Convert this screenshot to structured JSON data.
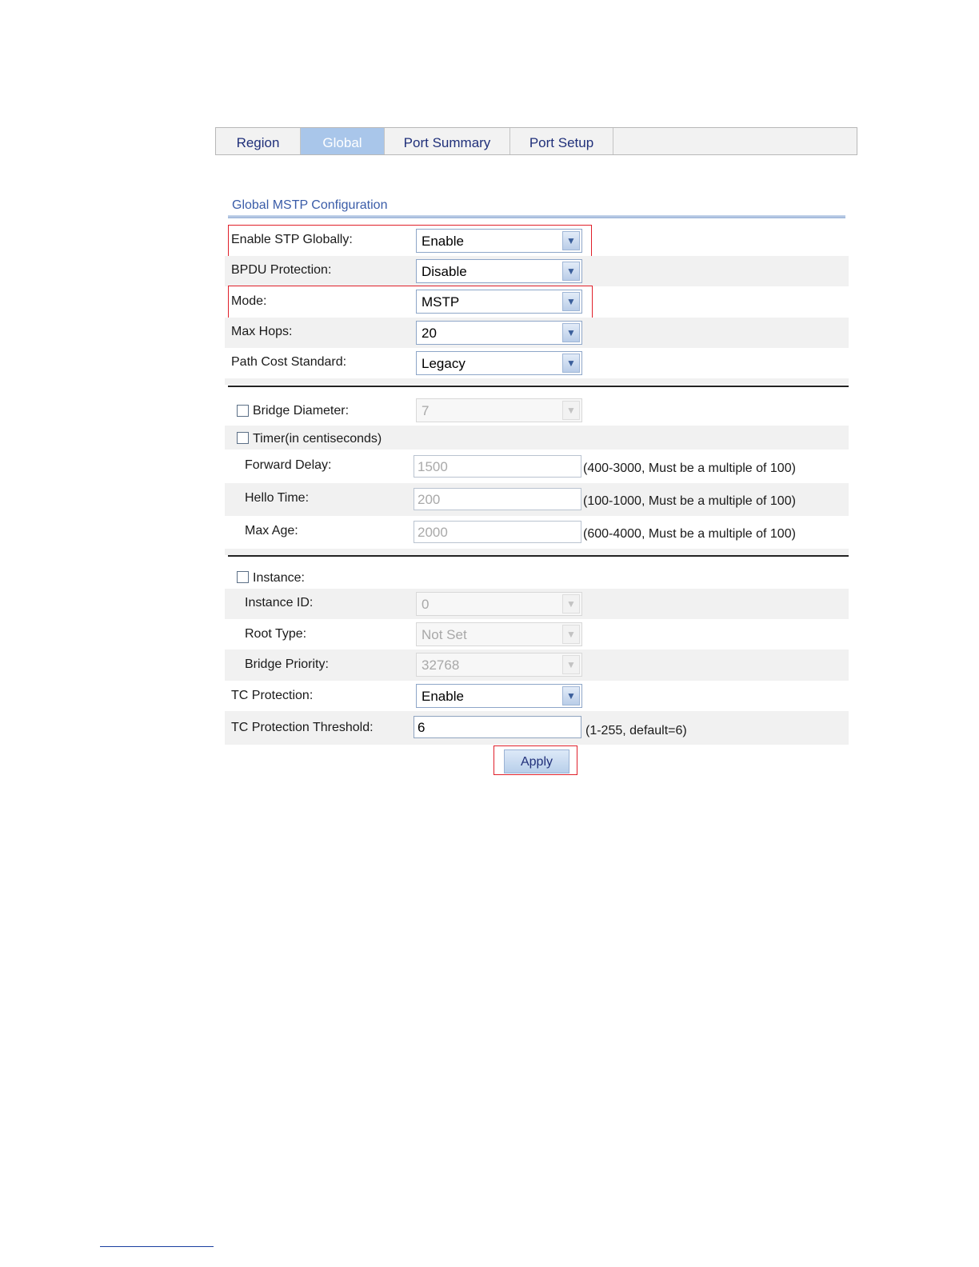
{
  "tabs": [
    {
      "label": "Region",
      "active": false
    },
    {
      "label": "Global",
      "active": true
    },
    {
      "label": "Port Summary",
      "active": false
    },
    {
      "label": "Port Setup",
      "active": false
    }
  ],
  "section_title": "Global MSTP Configuration",
  "fields": {
    "enable_stp": {
      "label": "Enable STP Globally:",
      "value": "Enable"
    },
    "bpdu_protection": {
      "label": "BPDU Protection:",
      "value": "Disable"
    },
    "mode": {
      "label": "Mode:",
      "value": "MSTP"
    },
    "max_hops": {
      "label": "Max Hops:",
      "value": "20"
    },
    "path_cost": {
      "label": "Path Cost Standard:",
      "value": "Legacy"
    },
    "bridge_diameter": {
      "label": "Bridge Diameter:",
      "value": "7",
      "checked": false
    },
    "timer": {
      "label": "Timer(in centiseconds)",
      "checked": false
    },
    "forward_delay": {
      "label": "Forward Delay:",
      "value": "1500",
      "hint": "(400-3000, Must be a multiple of 100)"
    },
    "hello_time": {
      "label": "Hello Time:",
      "value": "200",
      "hint": "(100-1000, Must be a multiple of 100)"
    },
    "max_age": {
      "label": "Max Age:",
      "value": "2000",
      "hint": "(600-4000, Must be a multiple of 100)"
    },
    "instance": {
      "label": "Instance:",
      "checked": false
    },
    "instance_id": {
      "label": "Instance ID:",
      "value": "0"
    },
    "root_type": {
      "label": "Root Type:",
      "value": "Not Set"
    },
    "bridge_priority": {
      "label": "Bridge Priority:",
      "value": "32768"
    },
    "tc_protection": {
      "label": "TC Protection:",
      "value": "Enable"
    },
    "tc_threshold": {
      "label": "TC Protection Threshold:",
      "value": "6",
      "hint": "(1-255, default=6)"
    }
  },
  "apply_label": "Apply",
  "colors": {
    "highlight": "#e0202a",
    "active_tab": "#a9c6ea",
    "title": "#3a5ca8"
  }
}
